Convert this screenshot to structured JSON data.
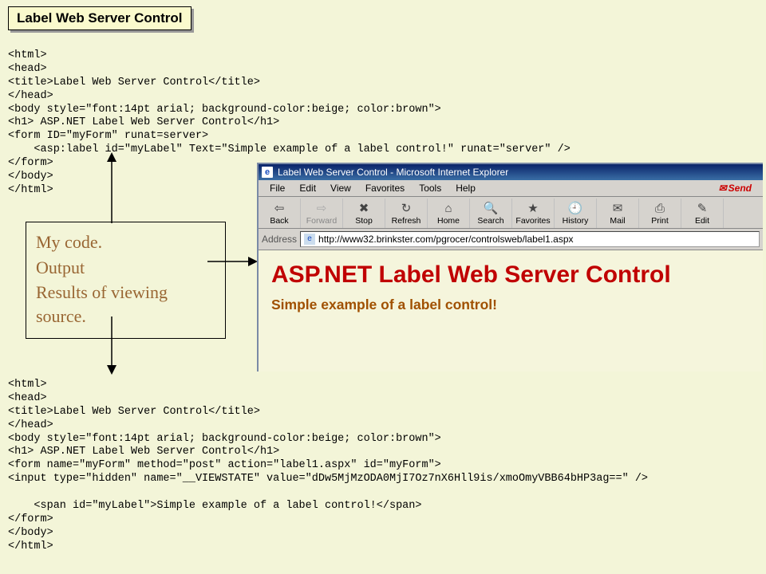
{
  "titleBox": "Label Web Server Control",
  "codeTop": "<html>\n<head>\n<title>Label Web Server Control</title>\n</head>\n<body style=\"font:14pt arial; background-color:beige; color:brown\">\n<h1> ASP.NET Label Web Server Control</h1>\n<form ID=\"myForm\" runat=server>\n    <asp:label id=\"myLabel\" Text=\"Simple example of a label control!\" runat=\"server\" />\n</form>\n</body>\n</html>",
  "annotation": {
    "line1": "My code.",
    "line2": "Output",
    "line3": "Results of viewing source."
  },
  "codeBottom": "<html>\n<head>\n<title>Label Web Server Control</title>\n</head>\n<body style=\"font:14pt arial; background-color:beige; color:brown\">\n<h1> ASP.NET Label Web Server Control</h1>\n<form name=\"myForm\" method=\"post\" action=\"label1.aspx\" id=\"myForm\">\n<input type=\"hidden\" name=\"__VIEWSTATE\" value=\"dDw5MjMzODA0MjI7Oz7nX6Hll9is/xmoOmyVBB64bHP3ag==\" />\n\n    <span id=\"myLabel\">Simple example of a label control!</span>\n</form>\n</body>\n</html>",
  "browser": {
    "title": "Label Web Server Control - Microsoft Internet Explorer",
    "menus": {
      "file": "File",
      "edit": "Edit",
      "view": "View",
      "favorites": "Favorites",
      "tools": "Tools",
      "help": "Help",
      "send": "Send"
    },
    "toolbar": {
      "back": "Back",
      "forward": "Forward",
      "stop": "Stop",
      "refresh": "Refresh",
      "home": "Home",
      "search": "Search",
      "favorites": "Favorites",
      "history": "History",
      "mail": "Mail",
      "print": "Print",
      "edit": "Edit"
    },
    "addressLabel": "Address",
    "url": "http://www32.brinkster.com/pgrocer/controlsweb/label1.aspx",
    "page": {
      "heading": "ASP.NET Label Web Server Control",
      "text": "Simple example of a label control!"
    }
  }
}
